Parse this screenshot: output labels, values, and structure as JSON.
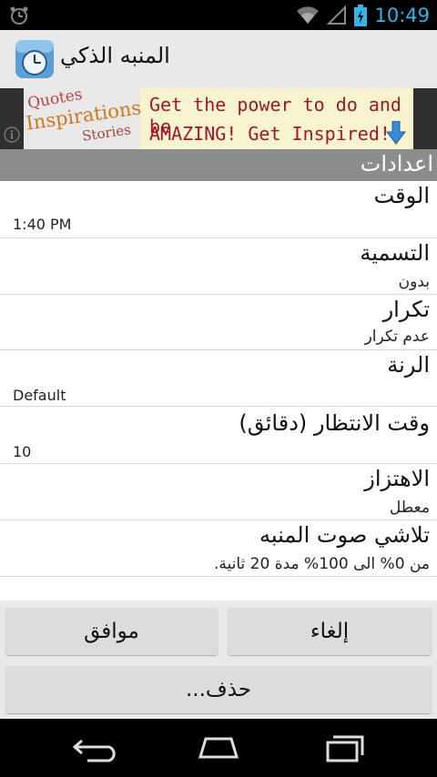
{
  "status_bar": {
    "time": "10:49"
  },
  "title_bar": {
    "app_title": "المنبه الذكي"
  },
  "ad": {
    "badge_line1": "Quotes",
    "badge_line2": "Inspirations",
    "badge_line3": "Stories",
    "text_line1": "Get the power to do and be",
    "text_line2": "AMAZING! Get Inspired!"
  },
  "section_header": "اعدادات",
  "settings": {
    "time": {
      "title": "الوقت",
      "value": "1:40 PM"
    },
    "label": {
      "title": "التسمية",
      "value": "بدون"
    },
    "repeat": {
      "title": "تكرار",
      "value": "عدم تكرار"
    },
    "ringtone": {
      "title": "الرنة",
      "value": "Default"
    },
    "snooze": {
      "title": "وقت الانتظار (دقائق)",
      "value": "10"
    },
    "vibrate": {
      "title": "الاهتزاز",
      "value": "معطل"
    },
    "fade": {
      "title": "تلاشي صوت المنبه",
      "value": "من 0% الى 100% مدة 20 ثانية."
    }
  },
  "buttons": {
    "ok": "موافق",
    "cancel": "إلغاء",
    "delete": "حذف..."
  },
  "colors": {
    "accent": "#34b5e5",
    "section": "#8c8c8c",
    "button": "#dcdcdc"
  }
}
